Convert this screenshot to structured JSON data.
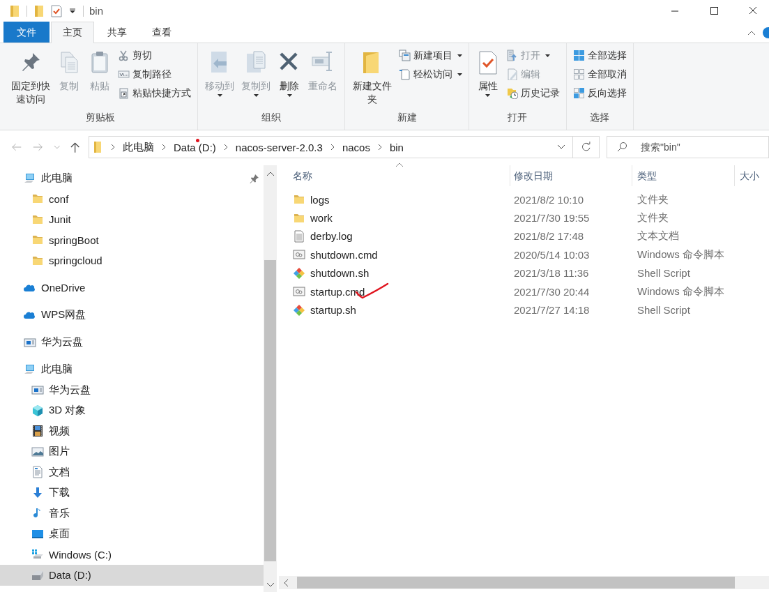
{
  "window": {
    "title": "bin"
  },
  "ribbon_tabs": [
    {
      "label": "文件",
      "kind": "file",
      "selected": false
    },
    {
      "label": "主页",
      "kind": "tab",
      "selected": true
    },
    {
      "label": "共享",
      "kind": "tab",
      "selected": false
    },
    {
      "label": "查看",
      "kind": "tab",
      "selected": false
    }
  ],
  "ribbon": {
    "groups": [
      {
        "label": "剪贴板",
        "items": [
          {
            "label": "固定到快速访问",
            "kind": "pin",
            "disabled": false,
            "dropdown": false
          },
          {
            "label": "复制",
            "kind": "copy",
            "disabled": true,
            "dropdown": false
          },
          {
            "label": "粘贴",
            "kind": "paste",
            "disabled": true,
            "dropdown": false
          },
          {
            "label": "剪切",
            "kind": "cut",
            "disabled": false,
            "dropdown": false
          },
          {
            "label": "复制路径",
            "kind": "copy-path",
            "disabled": false,
            "dropdown": false
          },
          {
            "label": "粘贴快捷方式",
            "kind": "paste-shortcut",
            "disabled": false,
            "dropdown": false
          }
        ]
      },
      {
        "label": "组织",
        "items": [
          {
            "label": "移动到",
            "kind": "move",
            "disabled": true,
            "dropdown": true
          },
          {
            "label": "复制到",
            "kind": "copy-to",
            "disabled": true,
            "dropdown": true
          },
          {
            "label": "删除",
            "kind": "delete",
            "disabled": false,
            "dropdown": true
          },
          {
            "label": "重命名",
            "kind": "rename",
            "disabled": true,
            "dropdown": false
          }
        ]
      },
      {
        "label": "新建",
        "items": [
          {
            "label": "新建文件夹",
            "kind": "new-folder",
            "disabled": false,
            "dropdown": false
          },
          {
            "label": "新建项目",
            "kind": "new-item",
            "disabled": false,
            "dropdown": true
          },
          {
            "label": "轻松访问",
            "kind": "easy-access",
            "disabled": false,
            "dropdown": true
          }
        ]
      },
      {
        "label": "打开",
        "items": [
          {
            "label": "属性",
            "kind": "properties",
            "disabled": false,
            "dropdown": true
          },
          {
            "label": "打开",
            "kind": "open",
            "disabled": true,
            "dropdown": true
          },
          {
            "label": "编辑",
            "kind": "edit",
            "disabled": true,
            "dropdown": false
          },
          {
            "label": "历史记录",
            "kind": "history",
            "disabled": false,
            "dropdown": false
          }
        ]
      },
      {
        "label": "选择",
        "items": [
          {
            "label": "全部选择",
            "kind": "select-all",
            "disabled": false,
            "dropdown": false
          },
          {
            "label": "全部取消",
            "kind": "select-none",
            "disabled": false,
            "dropdown": false
          },
          {
            "label": "反向选择",
            "kind": "invert",
            "disabled": false,
            "dropdown": false
          }
        ]
      }
    ]
  },
  "address_bar": {
    "path": [
      {
        "label": "此电脑",
        "marked": false
      },
      {
        "label": "Data (D:)",
        "marked": true
      },
      {
        "label": "nacos-server-2.0.3",
        "marked": false
      },
      {
        "label": "nacos",
        "marked": false
      },
      {
        "label": "bin",
        "marked": false
      }
    ],
    "search": {
      "placeholder": "搜索\"bin\""
    }
  },
  "navigation": {
    "quick_access": [
      {
        "label": "此电脑",
        "kind": "pc",
        "pinned": true,
        "selected": false
      },
      {
        "label": "conf",
        "kind": "folder",
        "pinned": false,
        "selected": false
      },
      {
        "label": "Junit",
        "kind": "folder",
        "pinned": false,
        "selected": false
      },
      {
        "label": "springBoot",
        "kind": "folder",
        "pinned": false,
        "selected": false
      },
      {
        "label": "springcloud",
        "kind": "folder",
        "pinned": false,
        "selected": false
      }
    ],
    "items": [
      {
        "label": "OneDrive",
        "kind": "cloud",
        "selected": false
      },
      {
        "label": "WPS网盘",
        "kind": "cloud",
        "selected": false
      },
      {
        "label": "华为云盘",
        "kind": "disk-app",
        "selected": false
      },
      {
        "label": "此电脑",
        "kind": "pc",
        "selected": false,
        "children": [
          {
            "label": "华为云盘",
            "kind": "disk-app",
            "selected": false
          },
          {
            "label": "3D 对象",
            "kind": "cube",
            "selected": false
          },
          {
            "label": "视频",
            "kind": "video",
            "selected": false
          },
          {
            "label": "图片",
            "kind": "image",
            "selected": false
          },
          {
            "label": "文档",
            "kind": "doc",
            "selected": false
          },
          {
            "label": "下载",
            "kind": "download",
            "selected": false
          },
          {
            "label": "音乐",
            "kind": "music",
            "selected": false
          },
          {
            "label": "桌面",
            "kind": "desktop",
            "selected": false
          },
          {
            "label": "Windows (C:)",
            "kind": "win-drive",
            "selected": false
          },
          {
            "label": "Data (D:)",
            "kind": "drive",
            "selected": true
          }
        ]
      }
    ]
  },
  "files": {
    "columns": [
      {
        "label": "名称",
        "sorted": true
      },
      {
        "label": "修改日期",
        "sorted": false
      },
      {
        "label": "类型",
        "sorted": false
      },
      {
        "label": "大小",
        "sorted": false
      }
    ],
    "rows": [
      {
        "name": "logs",
        "date": "2021/8/2 10:10",
        "type": "文件夹",
        "kind": "folder",
        "marked": false
      },
      {
        "name": "work",
        "date": "2021/7/30 19:55",
        "type": "文件夹",
        "kind": "folder",
        "marked": false
      },
      {
        "name": "derby.log",
        "date": "2021/8/2 17:48",
        "type": "文本文档",
        "kind": "text",
        "marked": false
      },
      {
        "name": "shutdown.cmd",
        "date": "2020/5/14 10:03",
        "type": "Windows 命令脚本",
        "kind": "cmd",
        "marked": false
      },
      {
        "name": "shutdown.sh",
        "date": "2021/3/18 11:36",
        "type": "Shell Script",
        "kind": "sh",
        "marked": false
      },
      {
        "name": "startup.cmd",
        "date": "2021/7/30 20:44",
        "type": "Windows 命令脚本",
        "kind": "cmd",
        "marked": true
      },
      {
        "name": "startup.sh",
        "date": "2021/7/27 14:18",
        "type": "Shell Script",
        "kind": "sh",
        "marked": false
      }
    ]
  }
}
